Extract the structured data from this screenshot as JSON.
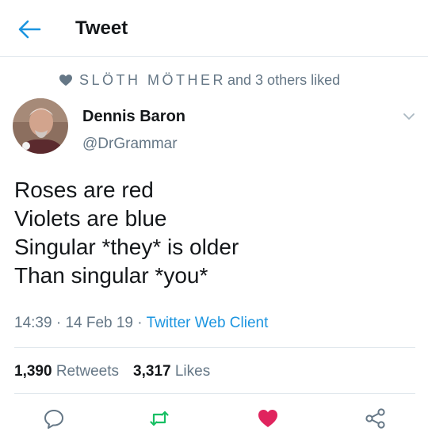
{
  "header": {
    "title": "Tweet",
    "back_icon": "arrow-left-icon"
  },
  "social_context": {
    "icon": "heart-icon",
    "names": "SLÖTH MÖTHER",
    "suffix": "and 3 others liked"
  },
  "author": {
    "display_name": "Dennis Baron",
    "handle": "@DrGrammar"
  },
  "tweet": {
    "lines": [
      "Roses are red",
      "Violets are blue",
      "Singular *they* is older",
      "Than singular *you*"
    ],
    "time": "14:39",
    "date": "14 Feb 19",
    "client": "Twitter Web Client"
  },
  "stats": {
    "retweets_count": "1,390",
    "retweets_label": "Retweets",
    "likes_count": "3,317",
    "likes_label": "Likes"
  },
  "actions": {
    "reply_icon": "reply-icon",
    "retweet_icon": "retweet-icon",
    "like_icon": "heart-icon",
    "share_icon": "share-icon"
  },
  "colors": {
    "accent": "#1b95e0",
    "retweet": "#17bf63",
    "like": "#e0245e",
    "secondary_text": "#657786"
  }
}
